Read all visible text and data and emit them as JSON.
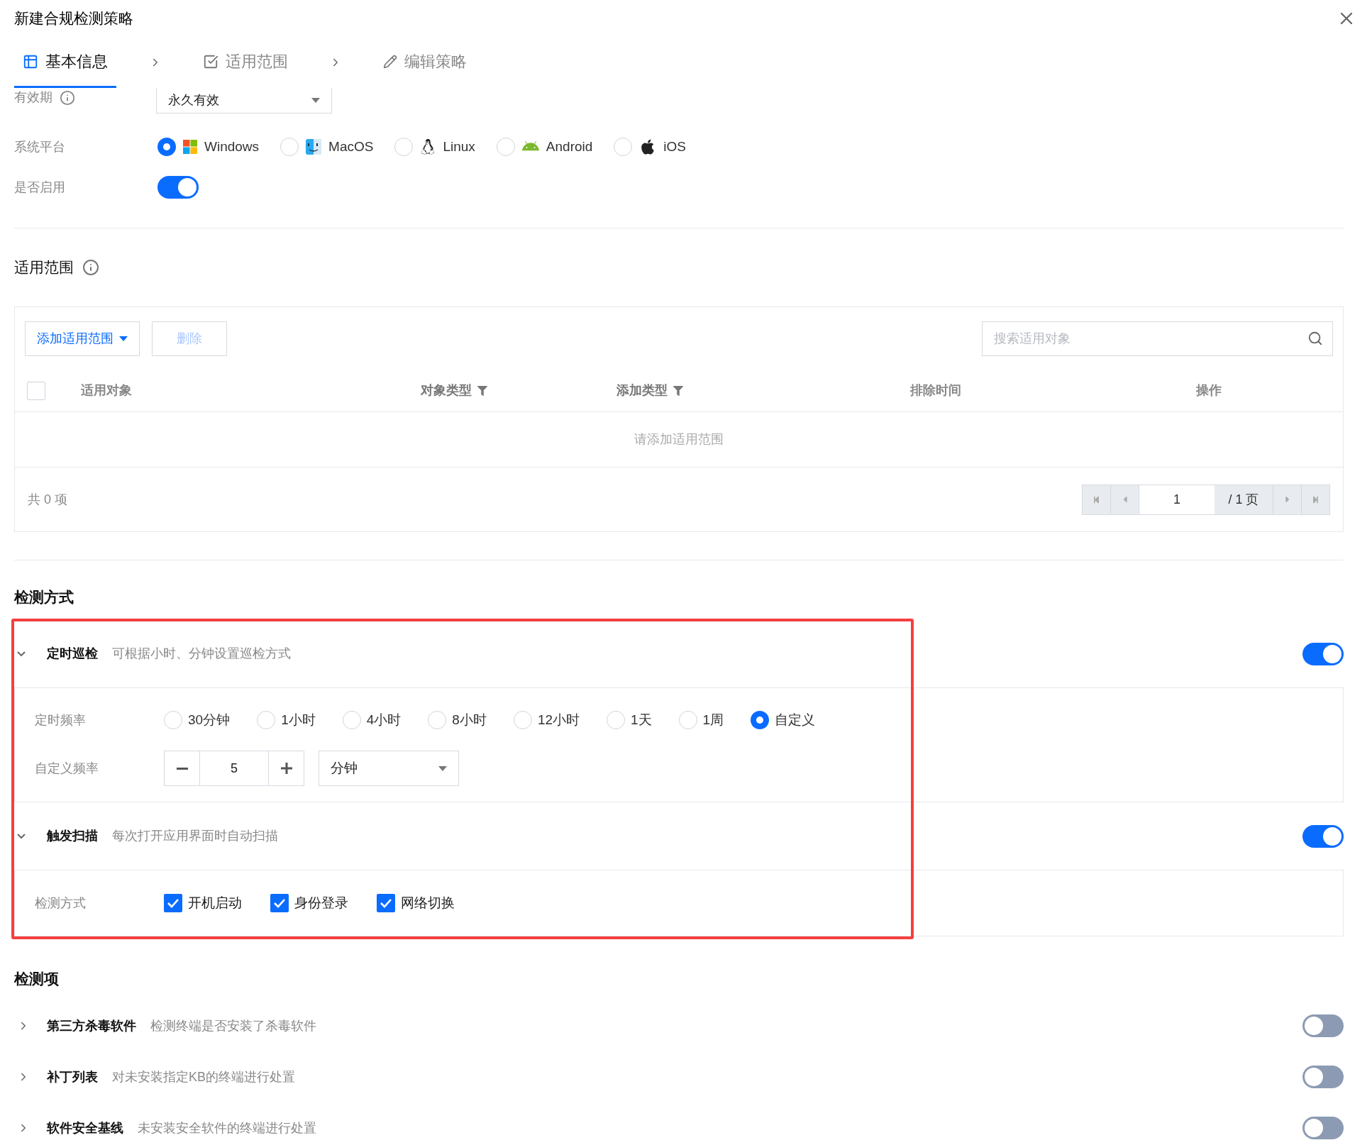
{
  "dialog": {
    "title": "新建合规检测策略"
  },
  "steps": [
    {
      "label": "基本信息",
      "selected": true
    },
    {
      "label": "适用范围",
      "selected": false
    },
    {
      "label": "编辑策略",
      "selected": false
    }
  ],
  "basic": {
    "validity": {
      "label": "有效期",
      "value": "永久有效"
    },
    "platform": {
      "label": "系统平台",
      "options": [
        {
          "kind": "windows",
          "label": "Windows",
          "selected": true
        },
        {
          "kind": "macos",
          "label": "MacOS",
          "selected": false
        },
        {
          "kind": "linux",
          "label": "Linux",
          "selected": false
        },
        {
          "kind": "android",
          "label": "Android",
          "selected": false
        },
        {
          "kind": "ios",
          "label": "iOS",
          "selected": false
        }
      ]
    },
    "enabled": {
      "label": "是否启用",
      "on": true
    }
  },
  "scope": {
    "title": "适用范围",
    "add_button": "添加适用范围",
    "delete_button": {
      "label": "删除",
      "disabled": true
    },
    "search": {
      "placeholder": "搜索适用对象"
    },
    "table": {
      "select_all_checked": false,
      "columns": [
        {
          "label": "适用对象",
          "filter": false
        },
        {
          "label": "对象类型",
          "filter": true
        },
        {
          "label": "添加类型",
          "filter": true
        },
        {
          "label": "排除时间",
          "filter": false
        },
        {
          "label": "操作",
          "filter": false
        }
      ],
      "empty_text": "请添加适用范围"
    },
    "total": "共 0 项",
    "pagination": {
      "page": "1",
      "pages": "/ 1 页"
    }
  },
  "detection_method": {
    "title": "检测方式",
    "sections": [
      {
        "kind": "schedule",
        "title": "定时巡检",
        "description": "可根据小时、分钟设置巡检方式",
        "on": true,
        "expanded": true,
        "frequency": {
          "label": "定时频率",
          "options": [
            {
              "label": "30分钟",
              "selected": false
            },
            {
              "label": "1小时",
              "selected": false
            },
            {
              "label": "4小时",
              "selected": false
            },
            {
              "label": "8小时",
              "selected": false
            },
            {
              "label": "12小时",
              "selected": false
            },
            {
              "label": "1天",
              "selected": false
            },
            {
              "label": "1周",
              "selected": false
            },
            {
              "label": "自定义",
              "selected": true
            }
          ]
        },
        "custom": {
          "label": "自定义频率",
          "value": "5",
          "unit": "分钟"
        }
      },
      {
        "kind": "trigger",
        "title": "触发扫描",
        "description": "每次打开应用界面时自动扫描",
        "on": true,
        "expanded": true,
        "methods": {
          "label": "检测方式",
          "options": [
            {
              "label": "开机启动",
              "checked": true
            },
            {
              "label": "身份登录",
              "checked": true
            },
            {
              "label": "网络切换",
              "checked": true
            }
          ]
        }
      }
    ]
  },
  "detection_items": {
    "title": "检测项",
    "items": [
      {
        "title": "第三方杀毒软件",
        "description": "检测终端是否安装了杀毒软件",
        "on": false,
        "expanded": false
      },
      {
        "title": "补丁列表",
        "description": "对未安装指定KB的终端进行处置",
        "on": false,
        "expanded": false
      },
      {
        "title": "软件安全基线",
        "description": "未安装安全软件的终端进行处置",
        "on": false,
        "expanded": false
      }
    ]
  }
}
